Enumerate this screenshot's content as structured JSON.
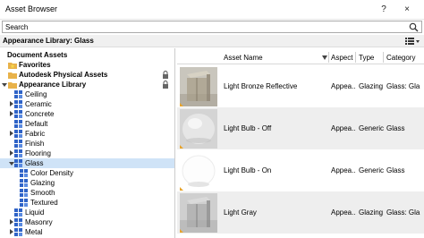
{
  "window": {
    "title": "Asset Browser",
    "help_label": "?",
    "close_label": "×"
  },
  "search": {
    "placeholder": "Search"
  },
  "library": {
    "label": "Appearance Library: Glass"
  },
  "tree": {
    "items": [
      {
        "label": "Document Assets"
      },
      {
        "label": "Favorites"
      },
      {
        "label": "Autodesk Physical Assets"
      },
      {
        "label": "Appearance Library"
      },
      {
        "label": "Ceiling"
      },
      {
        "label": "Ceramic"
      },
      {
        "label": "Concrete"
      },
      {
        "label": "Default"
      },
      {
        "label": "Fabric"
      },
      {
        "label": "Finish"
      },
      {
        "label": "Flooring"
      },
      {
        "label": "Glass"
      },
      {
        "label": "Color Density"
      },
      {
        "label": "Glazing"
      },
      {
        "label": "Smooth"
      },
      {
        "label": "Textured"
      },
      {
        "label": "Liquid"
      },
      {
        "label": "Masonry"
      },
      {
        "label": "Metal"
      }
    ]
  },
  "grid": {
    "columns": [
      "Asset Name",
      "Aspect",
      "Type",
      "Category"
    ],
    "rows": [
      {
        "name": "Light Bronze Reflective",
        "aspect": "Appea...",
        "type": "Glazing",
        "category": "Glass: Gla"
      },
      {
        "name": "Light Bulb - Off",
        "aspect": "Appea...",
        "type": "Generic",
        "category": "Glass"
      },
      {
        "name": "Light Bulb - On",
        "aspect": "Appea...",
        "type": "Generic",
        "category": "Glass"
      },
      {
        "name": "Light Gray",
        "aspect": "Appea...",
        "type": "Glazing",
        "category": "Glass: Gla"
      }
    ]
  },
  "colors": {
    "selection": "#cfe3f7",
    "folder": "#e8b24a",
    "cube": "#2f63c7"
  }
}
